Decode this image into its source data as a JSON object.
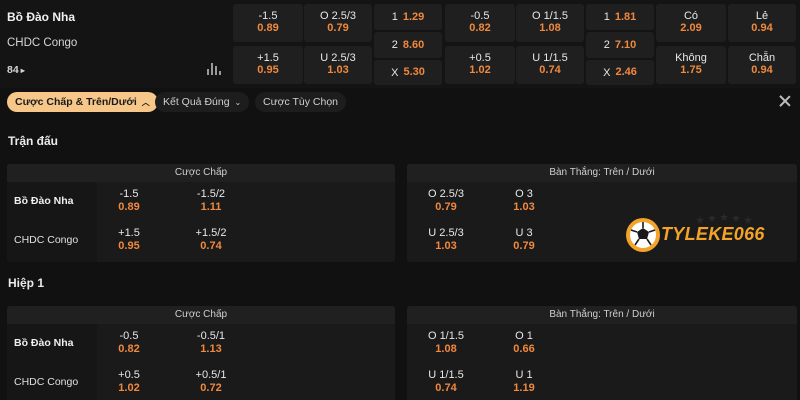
{
  "match": {
    "home": "Bồ Đào Nha",
    "away": "CHDC Congo",
    "more_count": "84",
    "more_arrow": "▸",
    "markets": [
      {
        "label": "-1.5",
        "odd": "0.89"
      },
      {
        "label": "+1.5",
        "odd": "0.95"
      },
      {
        "label": "O 2.5/3",
        "odd": "0.79"
      },
      {
        "label": "U 2.5/3",
        "odd": "1.03"
      },
      {
        "label": "1",
        "odd": "1.29"
      },
      {
        "label": "2",
        "odd": "8.60"
      },
      {
        "label": "X",
        "odd": "5.30"
      },
      {
        "label": "-0.5",
        "odd": "0.82"
      },
      {
        "label": "+0.5",
        "odd": "1.02"
      },
      {
        "label": "O 1/1.5",
        "odd": "1.08"
      },
      {
        "label": "U 1/1.5",
        "odd": "0.74"
      },
      {
        "label": "1",
        "odd": "1.81"
      },
      {
        "label": "2",
        "odd": "7.10"
      },
      {
        "label": "X",
        "odd": "2.46"
      },
      {
        "label": "Có",
        "odd": "2.09"
      },
      {
        "label": "Không",
        "odd": "1.75"
      },
      {
        "label": "Lẻ",
        "odd": "0.94"
      },
      {
        "label": "Chẵn",
        "odd": "0.94"
      }
    ]
  },
  "tabs": [
    {
      "label": "Cược Chấp & Trên/Dưới",
      "active": true
    },
    {
      "label": "Kết Quả Đúng",
      "chevron": "⌄"
    },
    {
      "label": "Cược Tùy Chọn"
    }
  ],
  "sections": [
    {
      "title": "Trận đấu",
      "handicap": {
        "header": "Cược Chấp",
        "rows": [
          {
            "team": "Bồ Đào Nha",
            "cells": [
              {
                "label": "-1.5",
                "odd": "0.89"
              },
              {
                "label": "-1.5/2",
                "odd": "1.11"
              }
            ]
          },
          {
            "team": "CHDC Congo",
            "cells": [
              {
                "label": "+1.5",
                "odd": "0.95"
              },
              {
                "label": "+1.5/2",
                "odd": "0.74"
              }
            ]
          }
        ]
      },
      "overunder": {
        "header": "Bàn Thắng: Trên / Dưới",
        "rows": [
          {
            "cells": [
              {
                "label": "O 2.5/3",
                "odd": "0.79"
              },
              {
                "label": "O 3",
                "odd": "1.03"
              }
            ]
          },
          {
            "cells": [
              {
                "label": "U 2.5/3",
                "odd": "1.03"
              },
              {
                "label": "U 3",
                "odd": "0.79"
              }
            ]
          }
        ]
      }
    },
    {
      "title": "Hiệp 1",
      "handicap": {
        "header": "Cược Chấp",
        "rows": [
          {
            "team": "Bồ Đào Nha",
            "cells": [
              {
                "label": "-0.5",
                "odd": "0.82"
              },
              {
                "label": "-0.5/1",
                "odd": "1.13"
              }
            ]
          },
          {
            "team": "CHDC Congo",
            "cells": [
              {
                "label": "+0.5",
                "odd": "1.02"
              },
              {
                "label": "+0.5/1",
                "odd": "0.72"
              }
            ]
          }
        ]
      },
      "overunder": {
        "header": "Bàn Thắng: Trên / Dưới",
        "rows": [
          {
            "cells": [
              {
                "label": "O 1/1.5",
                "odd": "1.08"
              },
              {
                "label": "O 1",
                "odd": "0.66"
              }
            ]
          },
          {
            "cells": [
              {
                "label": "U 1/1.5",
                "odd": "0.74"
              },
              {
                "label": "U 1",
                "odd": "1.19"
              }
            ]
          }
        ]
      }
    }
  ],
  "watermark": {
    "text": "TYLEKE066"
  },
  "colors": {
    "odds": "#f0883e",
    "active_tab": "#f6c788",
    "logo": "#f4a32a",
    "background": "#111111"
  }
}
